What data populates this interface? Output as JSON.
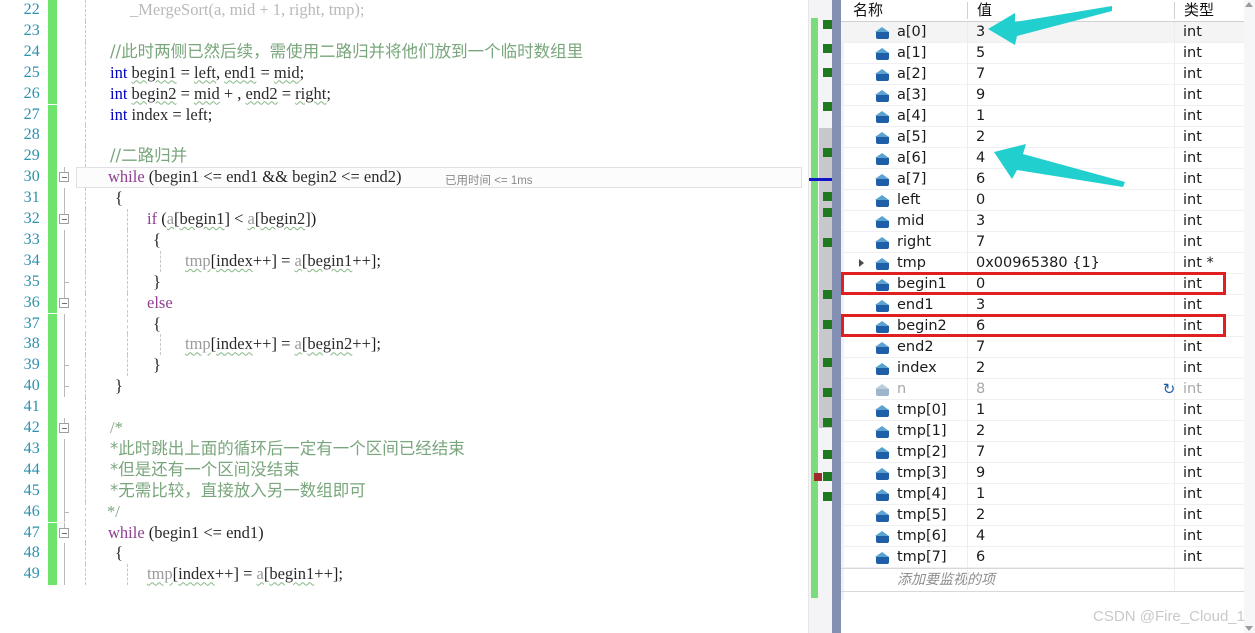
{
  "editor": {
    "first_line_number": 22,
    "perftip": "已用时间 <= 1ms",
    "lines": [
      {
        "n": 22,
        "text": "_MergeSort(a, mid + 1, right, tmp);"
      },
      {
        "n": 23,
        "text": ""
      },
      {
        "n": 24,
        "text": "//此时两侧已然后续，需使用二路归并将他们放到一个临时数组里"
      },
      {
        "n": 25,
        "text": "int begin1 = left, end1 = mid;"
      },
      {
        "n": 26,
        "text": "int begin2 = mid + 1, end2 = right;"
      },
      {
        "n": 27,
        "text": "int index = left;"
      },
      {
        "n": 28,
        "text": ""
      },
      {
        "n": 29,
        "text": "//二路归并"
      },
      {
        "n": 30,
        "text": "while (begin1 <= end1 && begin2 <= end2)"
      },
      {
        "n": 31,
        "text": "{"
      },
      {
        "n": 32,
        "text": "if (a[begin1] < a[begin2])"
      },
      {
        "n": 33,
        "text": "{"
      },
      {
        "n": 34,
        "text": "tmp[index++] = a[begin1++];"
      },
      {
        "n": 35,
        "text": "}"
      },
      {
        "n": 36,
        "text": "else"
      },
      {
        "n": 37,
        "text": "{"
      },
      {
        "n": 38,
        "text": "tmp[index++] = a[begin2++];"
      },
      {
        "n": 39,
        "text": "}"
      },
      {
        "n": 40,
        "text": "}"
      },
      {
        "n": 41,
        "text": ""
      },
      {
        "n": 42,
        "text": "/*"
      },
      {
        "n": 43,
        "text": "*此时跳出上面的循环后一定有一个区间已经结束"
      },
      {
        "n": 44,
        "text": "*但是还有一个区间没结束"
      },
      {
        "n": 45,
        "text": "*无需比较，直接放入另一数组即可"
      },
      {
        "n": 46,
        "text": "*/"
      },
      {
        "n": 47,
        "text": "while (begin1 <= end1)"
      },
      {
        "n": 48,
        "text": "{"
      },
      {
        "n": 49,
        "text": "tmp[index++] = a[begin1++];"
      }
    ]
  },
  "watch": {
    "columns": [
      "名称",
      "值",
      "类型"
    ],
    "add_placeholder": "添加要监视的项",
    "rows": [
      {
        "name": "a[0]",
        "value": "3",
        "type": "int",
        "expandable": false,
        "muted": false,
        "highlight": false
      },
      {
        "name": "a[1]",
        "value": "5",
        "type": "int",
        "expandable": false,
        "muted": false,
        "highlight": false
      },
      {
        "name": "a[2]",
        "value": "7",
        "type": "int",
        "expandable": false,
        "muted": false,
        "highlight": false
      },
      {
        "name": "a[3]",
        "value": "9",
        "type": "int",
        "expandable": false,
        "muted": false,
        "highlight": false
      },
      {
        "name": "a[4]",
        "value": "1",
        "type": "int",
        "expandable": false,
        "muted": false,
        "highlight": false
      },
      {
        "name": "a[5]",
        "value": "2",
        "type": "int",
        "expandable": false,
        "muted": false,
        "highlight": false
      },
      {
        "name": "a[6]",
        "value": "4",
        "type": "int",
        "expandable": false,
        "muted": false,
        "highlight": false
      },
      {
        "name": "a[7]",
        "value": "6",
        "type": "int",
        "expandable": false,
        "muted": false,
        "highlight": false
      },
      {
        "name": "left",
        "value": "0",
        "type": "int",
        "expandable": false,
        "muted": false,
        "highlight": false
      },
      {
        "name": "mid",
        "value": "3",
        "type": "int",
        "expandable": false,
        "muted": false,
        "highlight": false
      },
      {
        "name": "right",
        "value": "7",
        "type": "int",
        "expandable": false,
        "muted": false,
        "highlight": false
      },
      {
        "name": "tmp",
        "value": "0x00965380 {1}",
        "type": "int *",
        "expandable": true,
        "muted": false,
        "highlight": false
      },
      {
        "name": "begin1",
        "value": "0",
        "type": "int",
        "expandable": false,
        "muted": false,
        "highlight": true
      },
      {
        "name": "end1",
        "value": "3",
        "type": "int",
        "expandable": false,
        "muted": false,
        "highlight": false
      },
      {
        "name": "begin2",
        "value": "6",
        "type": "int",
        "expandable": false,
        "muted": false,
        "highlight": true
      },
      {
        "name": "end2",
        "value": "7",
        "type": "int",
        "expandable": false,
        "muted": false,
        "highlight": false
      },
      {
        "name": "index",
        "value": "2",
        "type": "int",
        "expandable": false,
        "muted": false,
        "highlight": false
      },
      {
        "name": "n",
        "value": "8",
        "type": "int",
        "expandable": false,
        "muted": true,
        "highlight": false,
        "refresh": "↻"
      },
      {
        "name": "tmp[0]",
        "value": "1",
        "type": "int",
        "expandable": false,
        "muted": false,
        "highlight": false
      },
      {
        "name": "tmp[1]",
        "value": "2",
        "type": "int",
        "expandable": false,
        "muted": false,
        "highlight": false
      },
      {
        "name": "tmp[2]",
        "value": "7",
        "type": "int",
        "expandable": false,
        "muted": false,
        "highlight": false
      },
      {
        "name": "tmp[3]",
        "value": "9",
        "type": "int",
        "expandable": false,
        "muted": false,
        "highlight": false
      },
      {
        "name": "tmp[4]",
        "value": "1",
        "type": "int",
        "expandable": false,
        "muted": false,
        "highlight": false
      },
      {
        "name": "tmp[5]",
        "value": "2",
        "type": "int",
        "expandable": false,
        "muted": false,
        "highlight": false
      },
      {
        "name": "tmp[6]",
        "value": "4",
        "type": "int",
        "expandable": false,
        "muted": false,
        "highlight": false
      },
      {
        "name": "tmp[7]",
        "value": "6",
        "type": "int",
        "expandable": false,
        "muted": false,
        "highlight": false
      }
    ]
  },
  "annotations": {
    "arrow_color": "#22cfcf",
    "box_color": "#e02020",
    "arrows": [
      {
        "target": "a[0] value"
      },
      {
        "target": "a[6] value"
      }
    ]
  },
  "watermark": "CSDN @Fire_Cloud_1"
}
